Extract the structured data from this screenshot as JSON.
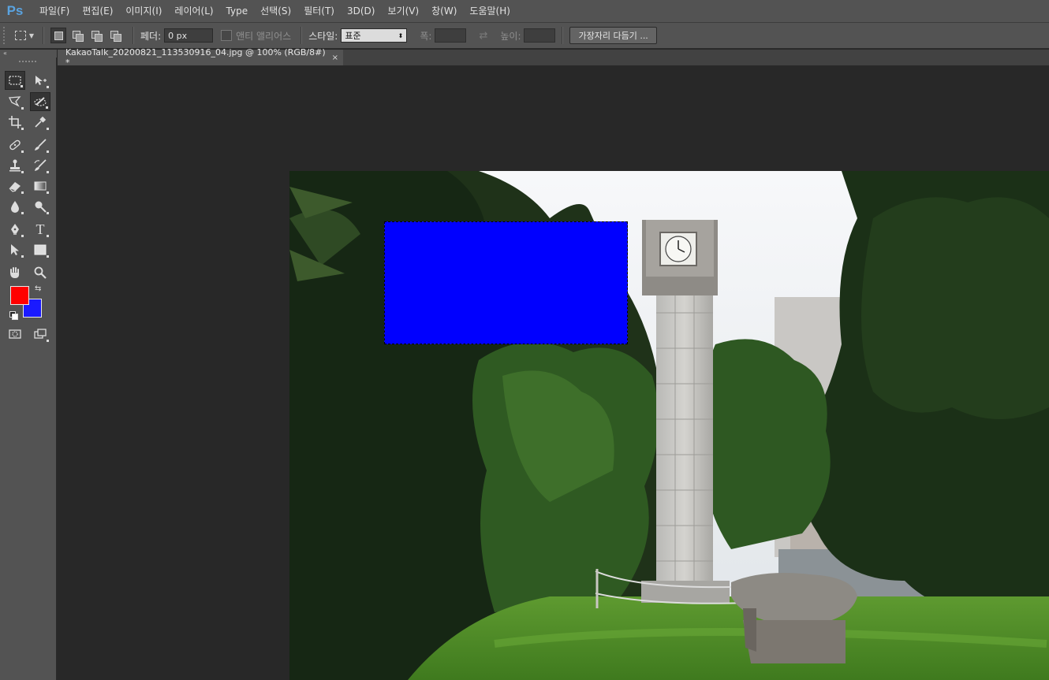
{
  "app": {
    "logo": "Ps",
    "menu": [
      "파일(F)",
      "편집(E)",
      "이미지(I)",
      "레이어(L)",
      "Type",
      "선택(S)",
      "필터(T)",
      "3D(D)",
      "보기(V)",
      "창(W)",
      "도움말(H)"
    ]
  },
  "options": {
    "feather_label": "페더:",
    "feather_value": "0 px",
    "antialias_label": "앤티 앨리어스",
    "style_label": "스타일:",
    "style_value": "표준",
    "width_label": "폭:",
    "height_label": "높이:",
    "refine_edge_label": "가장자리 다듬기 ..."
  },
  "tools": {
    "collapse_icon": "«",
    "type_tool_glyph": "T",
    "foreground_color": "#ff0000",
    "background_color": "#1a1aff",
    "active_tool": "quick-selection-tool"
  },
  "document": {
    "tab_title": "KakaoTalk_20200821_113530916_04.jpg @ 100% (RGB/8#) *",
    "close_icon": "×"
  },
  "selection": {
    "fill_color": "#0000ff"
  }
}
